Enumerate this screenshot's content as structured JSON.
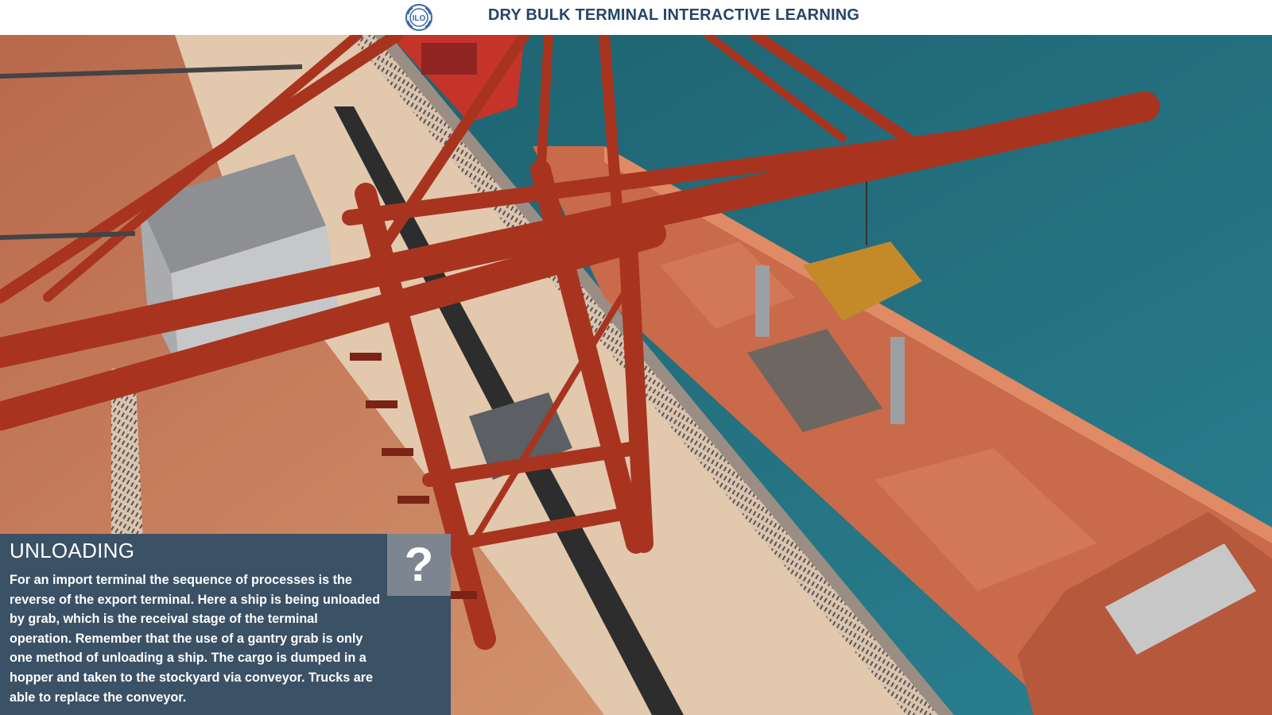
{
  "header": {
    "title": "DRY BULK TERMINAL INTERACTIVE LEARNING",
    "logo_icon": "ilo-logo-icon"
  },
  "scene": {
    "description_icon": "gantry-crane-unloading-scene"
  },
  "info_panel": {
    "heading": "UNLOADING",
    "body": "For an import terminal the sequence of processes is the reverse of the export terminal. Here a ship is being unloaded by grab, which is the receival stage of the terminal operation. Remember that the use of a gantry grab is only one method of unloading a ship. The cargo is dumped in a hopper and taken to the stockyard via conveyor. Trucks are able to replace the conveyor.",
    "help_label": "?",
    "help_icon": "question-mark-icon"
  },
  "colors": {
    "header_text": "#25456a",
    "panel_bg": "#3a5166",
    "help_bg": "#7d8690",
    "water": "#1f6a78",
    "crane_red": "#a8341f",
    "ground": "#c88a63"
  }
}
